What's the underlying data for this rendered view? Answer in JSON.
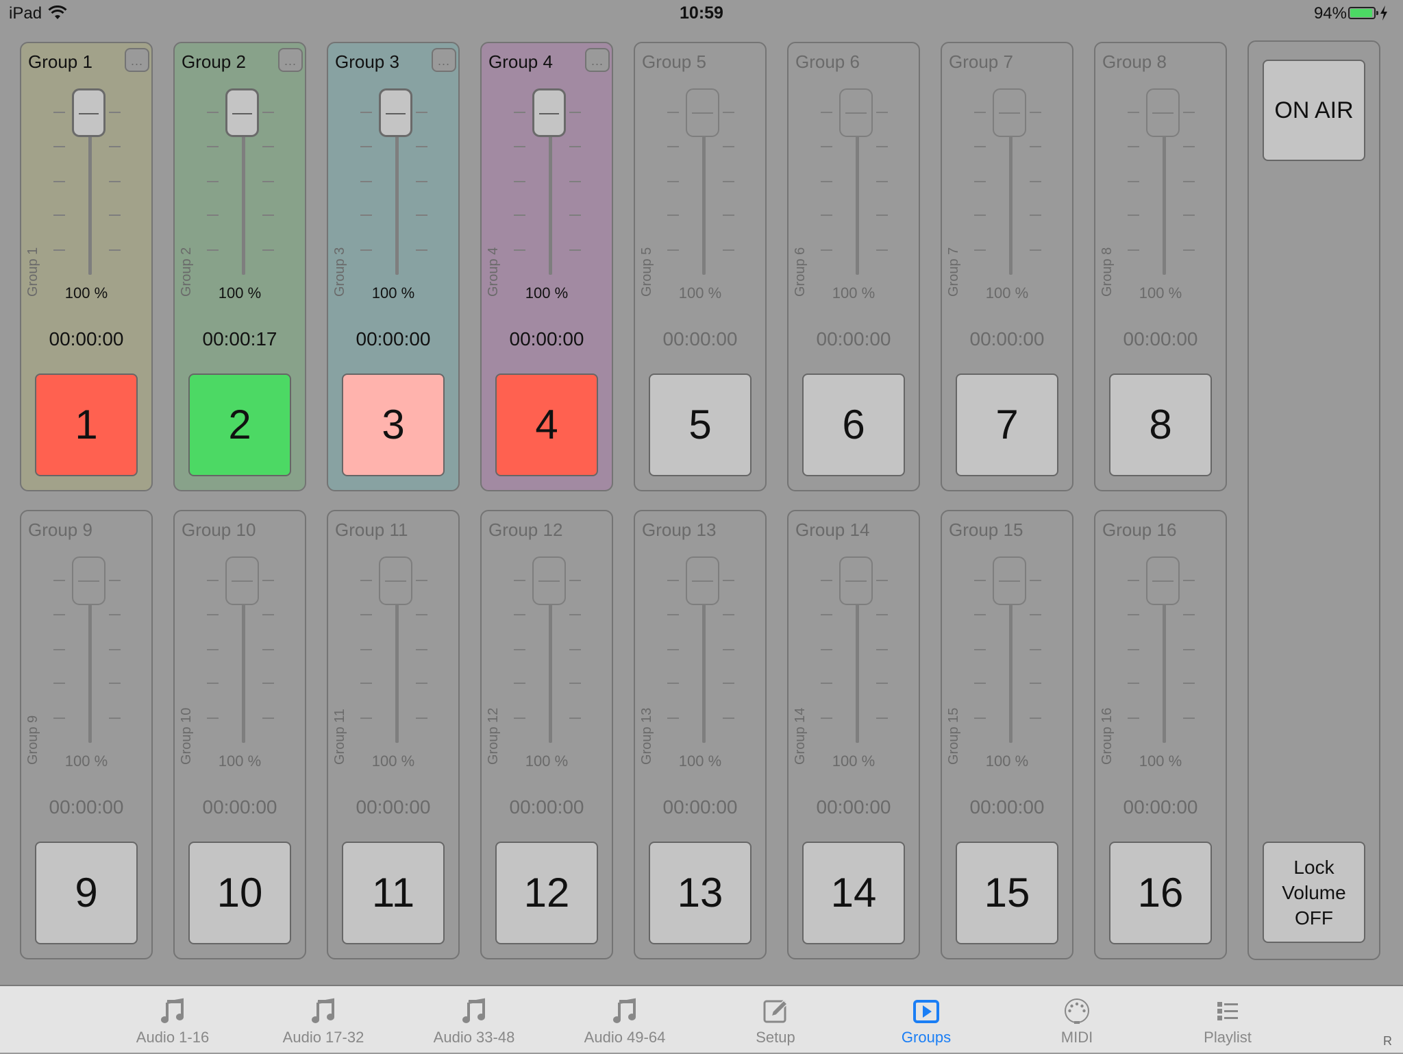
{
  "status_bar": {
    "device": "iPad",
    "time": "10:59",
    "battery_percent": "94%",
    "battery_level": 0.94,
    "charging": true
  },
  "colors": {
    "accent": "#1a7ef5",
    "background": "#9a9a9a",
    "playing_green": "#4cd964",
    "stop_red": "#ff6150",
    "light_red": "#ffb3ad",
    "idle_button": "#c4c4c4"
  },
  "groups": [
    {
      "title": "Group 1",
      "vertical_label": "Group 1",
      "volume": "100 %",
      "volume_value": 100,
      "time": "00:00:00",
      "button": "1",
      "active": true,
      "has_menu": true,
      "menu_label": "...",
      "panel_color": "#a2a28a",
      "button_color": "#ff6150"
    },
    {
      "title": "Group 2",
      "vertical_label": "Group 2",
      "volume": "100 %",
      "volume_value": 100,
      "time": "00:00:17",
      "button": "2",
      "active": true,
      "has_menu": true,
      "menu_label": "...",
      "panel_color": "#88a28a",
      "button_color": "#4cd964"
    },
    {
      "title": "Group 3",
      "vertical_label": "Group 3",
      "volume": "100 %",
      "volume_value": 100,
      "time": "00:00:00",
      "button": "3",
      "active": true,
      "has_menu": true,
      "menu_label": "...",
      "panel_color": "#88a2a2",
      "button_color": "#ffb3ad"
    },
    {
      "title": "Group 4",
      "vertical_label": "Group 4",
      "volume": "100 %",
      "volume_value": 100,
      "time": "00:00:00",
      "button": "4",
      "active": true,
      "has_menu": true,
      "menu_label": "...",
      "panel_color": "#a28aa2",
      "button_color": "#ff6150"
    },
    {
      "title": "Group 5",
      "vertical_label": "Group 5",
      "volume": "100 %",
      "volume_value": 100,
      "time": "00:00:00",
      "button": "5",
      "active": false
    },
    {
      "title": "Group 6",
      "vertical_label": "Group 6",
      "volume": "100 %",
      "volume_value": 100,
      "time": "00:00:00",
      "button": "6",
      "active": false
    },
    {
      "title": "Group 7",
      "vertical_label": "Group 7",
      "volume": "100 %",
      "volume_value": 100,
      "time": "00:00:00",
      "button": "7",
      "active": false
    },
    {
      "title": "Group 8",
      "vertical_label": "Group 8",
      "volume": "100 %",
      "volume_value": 100,
      "time": "00:00:00",
      "button": "8",
      "active": false
    },
    {
      "title": "Group 9",
      "vertical_label": "Group 9",
      "volume": "100 %",
      "volume_value": 100,
      "time": "00:00:00",
      "button": "9",
      "active": false
    },
    {
      "title": "Group 10",
      "vertical_label": "Group 10",
      "volume": "100 %",
      "volume_value": 100,
      "time": "00:00:00",
      "button": "10",
      "active": false
    },
    {
      "title": "Group 11",
      "vertical_label": "Group 11",
      "volume": "100 %",
      "volume_value": 100,
      "time": "00:00:00",
      "button": "11",
      "active": false
    },
    {
      "title": "Group 12",
      "vertical_label": "Group 12",
      "volume": "100 %",
      "volume_value": 100,
      "time": "00:00:00",
      "button": "12",
      "active": false
    },
    {
      "title": "Group 13",
      "vertical_label": "Group 13",
      "volume": "100 %",
      "volume_value": 100,
      "time": "00:00:00",
      "button": "13",
      "active": false
    },
    {
      "title": "Group 14",
      "vertical_label": "Group 14",
      "volume": "100 %",
      "volume_value": 100,
      "time": "00:00:00",
      "button": "14",
      "active": false
    },
    {
      "title": "Group 15",
      "vertical_label": "Group 15",
      "volume": "100 %",
      "volume_value": 100,
      "time": "00:00:00",
      "button": "15",
      "active": false
    },
    {
      "title": "Group 16",
      "vertical_label": "Group 16",
      "volume": "100 %",
      "volume_value": 100,
      "time": "00:00:00",
      "button": "16",
      "active": false
    }
  ],
  "side_panel": {
    "on_air_label": "ON AIR",
    "lock_volume_lines": [
      "Lock",
      "Volume",
      "OFF"
    ]
  },
  "tabbar": {
    "tabs": [
      {
        "label": "Audio 1-16",
        "icon": "music-note-icon",
        "active": false
      },
      {
        "label": "Audio 17-32",
        "icon": "music-note-icon",
        "active": false
      },
      {
        "label": "Audio 33-48",
        "icon": "music-note-icon",
        "active": false
      },
      {
        "label": "Audio 49-64",
        "icon": "music-note-icon",
        "active": false
      },
      {
        "label": "Setup",
        "icon": "edit-icon",
        "active": false
      },
      {
        "label": "Groups",
        "icon": "play-icon",
        "active": true
      },
      {
        "label": "MIDI",
        "icon": "midi-icon",
        "active": false
      },
      {
        "label": "Playlist",
        "icon": "list-icon",
        "active": false
      }
    ],
    "corner_label": "R"
  }
}
